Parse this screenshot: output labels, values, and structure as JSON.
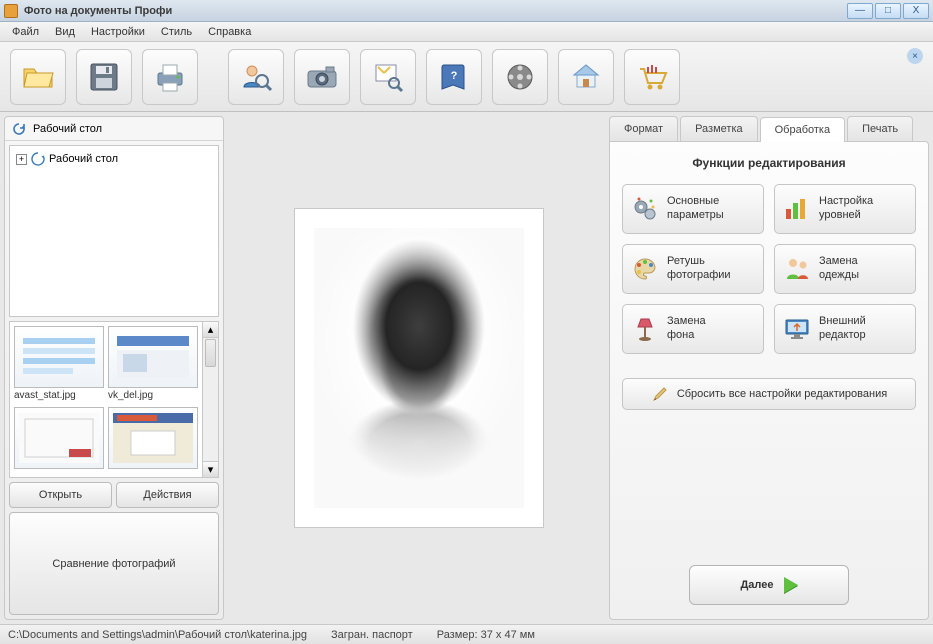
{
  "window": {
    "title": "Фото на документы Профи",
    "minimize": "—",
    "maximize": "□",
    "close": "X"
  },
  "menu": {
    "items": [
      "Файл",
      "Вид",
      "Настройки",
      "Стиль",
      "Справка"
    ]
  },
  "toolbar": {
    "icons": [
      "folder-open",
      "save",
      "print",
      "find-person",
      "camera",
      "crop-selection",
      "help-book",
      "film-reel",
      "home",
      "shopping-cart"
    ]
  },
  "left": {
    "location_label": "Рабочий стол",
    "tree": {
      "root_label": "Рабочий стол"
    },
    "thumbs": [
      {
        "name": "avast_stat.jpg"
      },
      {
        "name": "vk_del.jpg"
      },
      {
        "name": ""
      },
      {
        "name": ""
      }
    ],
    "open_btn": "Открыть",
    "actions_btn": "Действия",
    "compare_btn": "Сравнение фотографий"
  },
  "tabs": {
    "items": [
      "Формат",
      "Разметка",
      "Обработка",
      "Печать"
    ],
    "active_index": 2
  },
  "editing": {
    "title": "Функции редактирования",
    "buttons": [
      {
        "icon": "gears",
        "line1": "Основные",
        "line2": "параметры"
      },
      {
        "icon": "bars",
        "line1": "Настройка",
        "line2": "уровней"
      },
      {
        "icon": "palette",
        "line1": "Ретушь",
        "line2": "фотографии"
      },
      {
        "icon": "people",
        "line1": "Замена",
        "line2": "одежды"
      },
      {
        "icon": "lamp",
        "line1": "Замена",
        "line2": "фона"
      },
      {
        "icon": "monitor",
        "line1": "Внешний",
        "line2": "редактор"
      }
    ],
    "reset": "Сбросить все настройки редактирования",
    "next": "Далее"
  },
  "status": {
    "path": "C:\\Documents and Settings\\admin\\Рабочий стол\\katerina.jpg",
    "doc_type": "Загран. паспорт",
    "size": "Размер: 37 x 47 мм"
  }
}
